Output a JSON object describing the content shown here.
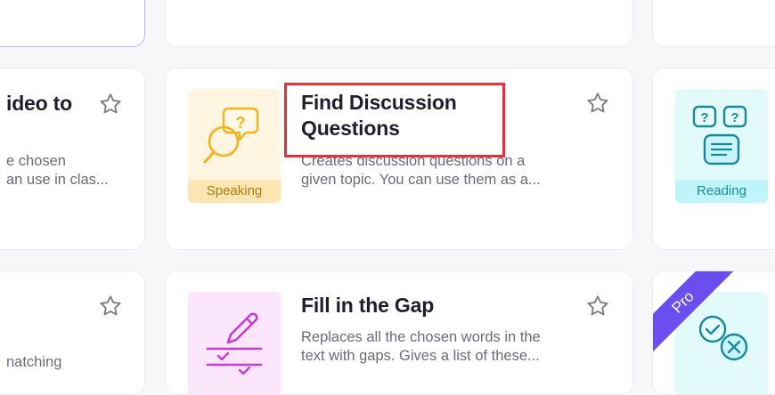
{
  "cards": {
    "video": {
      "title": "ideo to",
      "desc_line1": "e chosen",
      "desc_line2": "an use in clas..."
    },
    "discussion": {
      "title_line1": "Find Discussion",
      "title_line2": "Questions",
      "desc_line1": "Creates discussion questions on a",
      "desc_line2": "given topic. You can use them as a...",
      "tag": "Speaking"
    },
    "reading": {
      "tag": "Reading"
    },
    "matching": {
      "desc_line1": "natching"
    },
    "gap": {
      "title": "Fill in the Gap",
      "desc_line1": "Replaces all the chosen words in the",
      "desc_line2": "text with gaps. Gives a list of these..."
    },
    "pro": {
      "ribbon": "Pro"
    }
  },
  "icons": [
    "star-icon",
    "question-bubbles-icon",
    "chat-question-icon",
    "pencil-lines-icon",
    "check-cross-icon"
  ],
  "colors": {
    "highlight": "#e8303a",
    "speaking_bg": "#fff5e0",
    "reading_bg": "#e3fafb",
    "gap_bg": "#fbe6fb",
    "pro_ribbon": "#6b4ef0"
  }
}
